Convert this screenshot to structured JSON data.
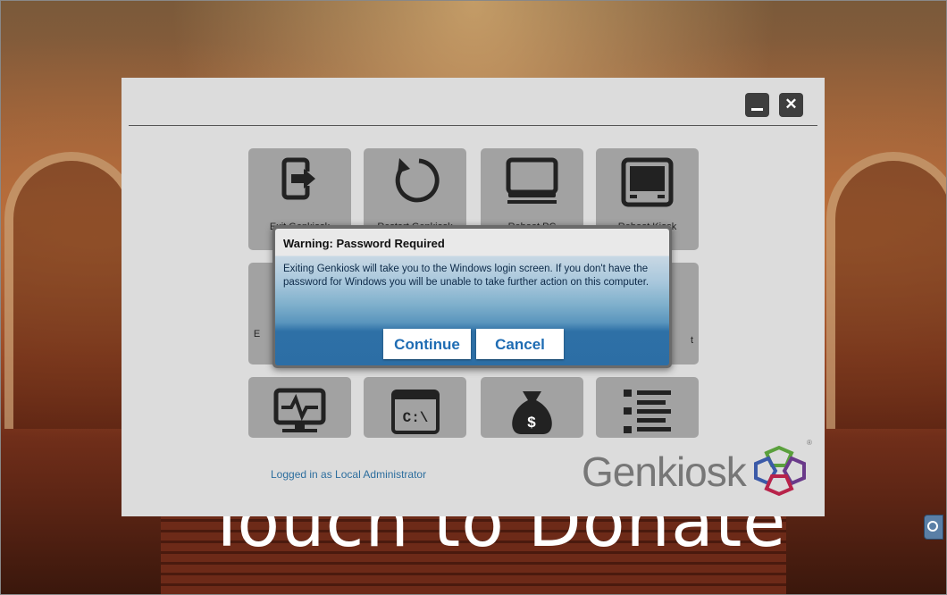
{
  "background": {
    "banner_text": "Touch to Donate"
  },
  "window_controls": {
    "minimize_icon": "minimize-icon",
    "close_icon": "close-icon",
    "close_glyph": "✕"
  },
  "tiles": {
    "row1": [
      {
        "icon": "exit-icon",
        "label": "Exit Genkiosk"
      },
      {
        "icon": "restart-icon",
        "label": "Restart Genkiosk"
      },
      {
        "icon": "computer-icon",
        "label": "Reboot PC"
      },
      {
        "icon": "kiosk-icon",
        "label": "Reboot Kiosk"
      }
    ],
    "row2": [
      {
        "icon": "",
        "label": "E"
      },
      {
        "icon": "",
        "label": ""
      },
      {
        "icon": "",
        "label": ""
      },
      {
        "icon": "",
        "label": "t"
      }
    ],
    "row3": [
      {
        "icon": "monitor-health-icon",
        "label": ""
      },
      {
        "icon": "command-prompt-icon",
        "label": "C:\\"
      },
      {
        "icon": "money-bag-icon",
        "label": "$"
      },
      {
        "icon": "list-icon",
        "label": ""
      }
    ]
  },
  "footer": {
    "logged_in_text": "Logged in as Local Administrator",
    "logo_text": "Genkiosk",
    "logo_reg": "®"
  },
  "dialog": {
    "title": "Warning: Password Required",
    "message": "Exiting Genkiosk will take you to the Windows login screen. If you don't have the password for Windows you will be unable to take further action on this computer.",
    "continue_label": "Continue",
    "cancel_label": "Cancel"
  },
  "colors": {
    "panel_bg": "#dcdcdc",
    "tile_bg": "#a2a2a2",
    "dialog_button_text": "#1e6cb3",
    "logged_in_text": "#2d6e9e"
  }
}
